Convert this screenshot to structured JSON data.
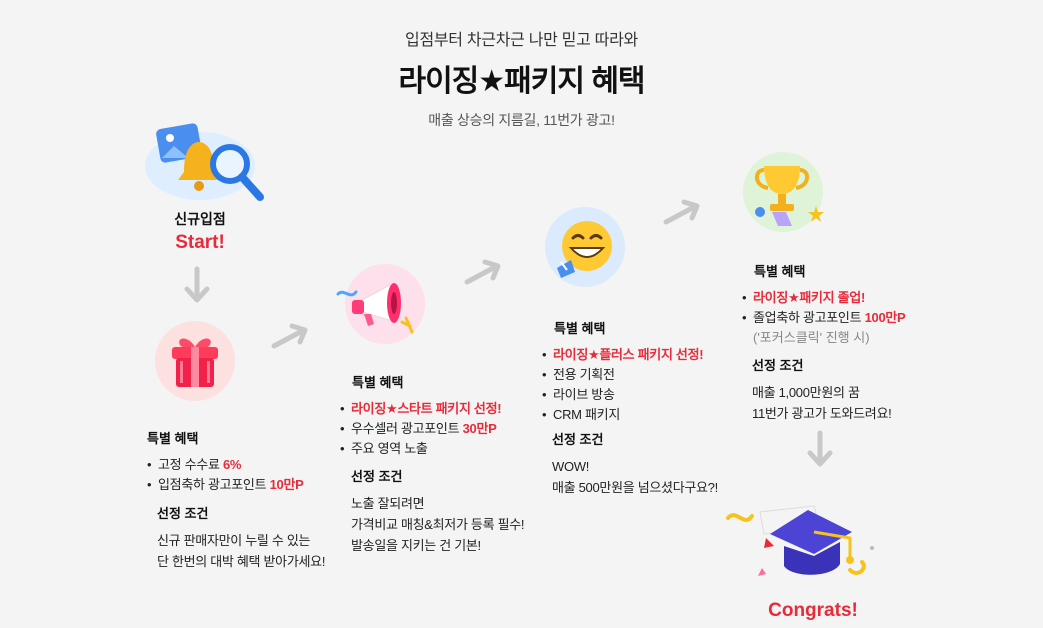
{
  "header": {
    "subtitle": "입점부터 차근차근 나만 믿고 따라와",
    "title": "라이징★패키지 혜택",
    "caption": "매출 상승의 지름길, 11번가 광고!"
  },
  "step0": {
    "label": "신규입점",
    "start": "Start!"
  },
  "step1": {
    "benefit_title": "특별 혜택",
    "benefits": [
      {
        "pre": "고정 수수료 ",
        "hl": "6%"
      },
      {
        "pre": "입점축하 광고포인트 ",
        "hl": "10만P"
      }
    ],
    "cond_title": "선정 조건",
    "cond_lines": [
      "신규 판매자만이 누릴 수 있는",
      "단 한번의 대박 혜택 받아가세요!"
    ]
  },
  "step2": {
    "benefit_title": "특별 혜택",
    "benefits": [
      {
        "pre": "",
        "hl": "라이징★스타트 패키지 선정!"
      },
      {
        "pre": "우수셀러 광고포인트 ",
        "hl": "30만P"
      },
      {
        "pre": "주요 영역 노출",
        "hl": ""
      }
    ],
    "cond_title": "선정 조건",
    "cond_lines": [
      "노출 잘되려면",
      "가격비교 매칭&최저가 등록 필수!",
      "발송일을 지키는 건 기본!"
    ]
  },
  "step3": {
    "benefit_title": "특별 혜택",
    "benefits": [
      {
        "pre": "",
        "hl": "라이징★플러스 패키지 선정!"
      },
      {
        "pre": "전용 기획전",
        "hl": ""
      },
      {
        "pre": "라이브 방송",
        "hl": ""
      },
      {
        "pre": "CRM 패키지",
        "hl": ""
      }
    ],
    "cond_title": "선정 조건",
    "cond_lines": [
      "WOW!",
      "매출 500만원을 넘으셨다구요?!"
    ]
  },
  "step4": {
    "benefit_title": "특별 혜택",
    "benefits": [
      {
        "pre": "",
        "hl": "라이징★패키지 졸업!"
      },
      {
        "pre": "졸업축하 광고포인트 ",
        "hl": "100만P"
      }
    ],
    "note": "('포커스클릭' 진행 시)",
    "cond_title": "선정 조건",
    "cond_lines": [
      "매출 1,000만원의 꿈",
      "11번가 광고가 도와드려요!"
    ]
  },
  "final": {
    "congrats": "Congrats!"
  },
  "colors": {
    "accent_red": "#e82a3a",
    "arrow_grey": "#c8c8c8"
  }
}
